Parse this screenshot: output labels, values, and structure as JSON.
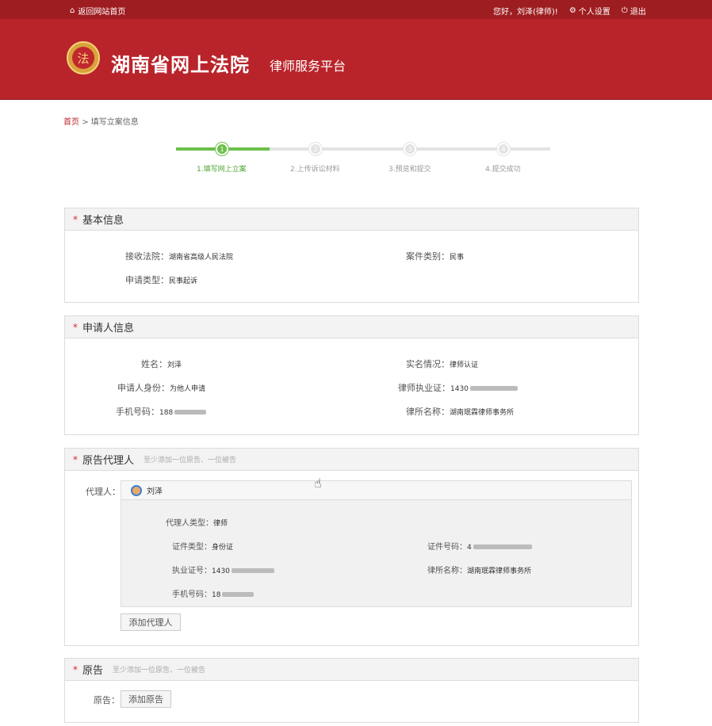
{
  "topbar": {
    "home_label": "返回网站首页",
    "greeting": "您好，刘泽(律师)!",
    "settings_label": "个人设置",
    "logout_label": "退出"
  },
  "header": {
    "title": "湖南省网上法院",
    "subtitle": "律师服务平台"
  },
  "breadcrumb": {
    "home": "首页",
    "separator": ">",
    "current": "填写立案信息"
  },
  "steps": [
    {
      "num": "1",
      "label": "1.填写网上立案",
      "active": true
    },
    {
      "num": "2",
      "label": "2.上传诉讼材料",
      "active": false
    },
    {
      "num": "3",
      "label": "3.预览和提交",
      "active": false
    },
    {
      "num": "4",
      "label": "4.提交成功",
      "active": false
    }
  ],
  "basic": {
    "title": "基本信息",
    "court_label": "接收法院：",
    "court_value": "湖南省高级人民法院",
    "category_label": "案件类别：",
    "category_value": "民事",
    "apply_type_label": "申请类型：",
    "apply_type_value": "民事起诉"
  },
  "applicant": {
    "title": "申请人信息",
    "name_label": "姓名：",
    "name_value": "刘泽",
    "realname_label": "实名情况：",
    "realname_value": "律师认证",
    "identity_label": "申请人身份：",
    "identity_value": "为他人申请",
    "license_label": "律师执业证：",
    "license_value": "1430",
    "phone_label": "手机号码：",
    "phone_value": "188",
    "firm_label": "律所名称：",
    "firm_value": "湖南珉霖律师事务所"
  },
  "agent_section": {
    "title": "原告代理人",
    "hint": "至少添加一位原告、一位被告",
    "agent_label": "代理人：",
    "agent_name": "刘泽",
    "type_label": "代理人类型：",
    "type_value": "律师",
    "cert_type_label": "证件类型：",
    "cert_type_value": "身份证",
    "cert_no_label": "证件号码：",
    "cert_no_value": "4",
    "practice_label": "执业证号：",
    "practice_value": "1430",
    "firm_label": "律所名称：",
    "firm_value": "湖南珉霖律师事务所",
    "phone_label": "手机号码：",
    "phone_value": "18",
    "add_button": "添加代理人"
  },
  "plaintiff": {
    "title": "原告",
    "hint": "至少添加一位原告、一位被告",
    "label": "原告：",
    "add_button": "添加原告"
  },
  "colors": {
    "brand_red": "#b9242a",
    "top_red": "#9e1d20",
    "step_green": "#6cc04a"
  }
}
